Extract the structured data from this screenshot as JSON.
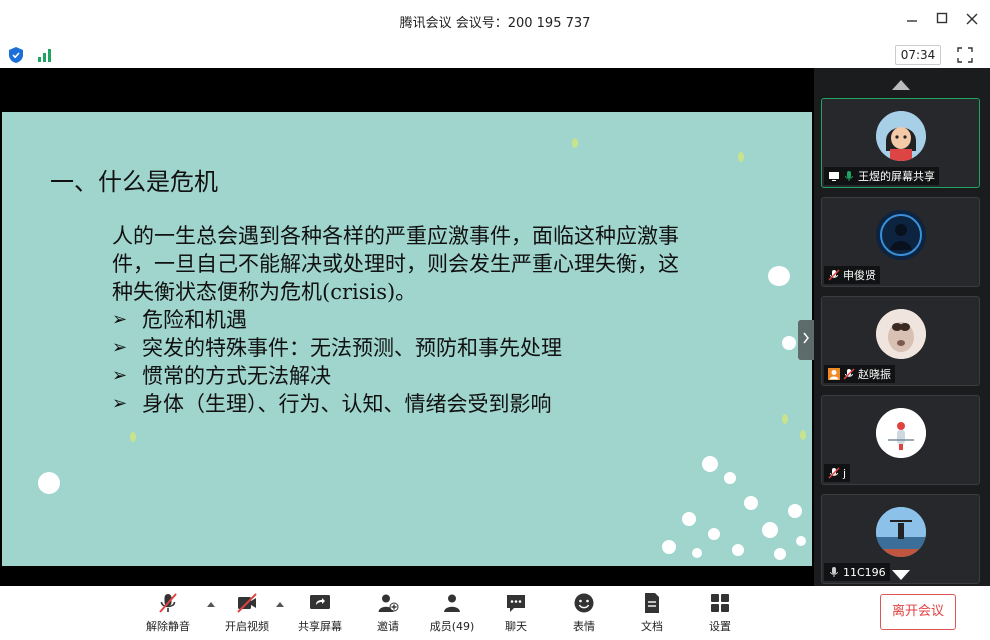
{
  "window": {
    "title": "腾讯会议 会议号：200 195 737",
    "timer": "07:34"
  },
  "slide": {
    "heading": "一、什么是危机",
    "paragraph": "人的一生总会遇到各种各样的严重应激事件，面临这种应激事件，一旦自己不能解决或处理时，则会发生严重心理失衡，这种失衡状态便称为危机(crisis)。",
    "bullet_marker": "➢",
    "bullets": [
      "危险和机遇",
      "突发的特殊事件：无法预测、预防和事先处理",
      "惯常的方式无法解决",
      "身体（生理）、行为、认知、情绪会受到影响"
    ]
  },
  "participants": [
    {
      "name": "王煜的屏幕共享",
      "mic": "on",
      "sharing": true
    },
    {
      "name": "申俊贤",
      "mic": "muted"
    },
    {
      "name": "赵晓振",
      "mic": "muted",
      "badge": true
    },
    {
      "name": "j",
      "mic": "muted"
    },
    {
      "name": "11C196",
      "mic": "on"
    }
  ],
  "toolbar": {
    "unmute": "解除静音",
    "video": "开启视频",
    "share": "共享屏幕",
    "invite": "邀请",
    "members": "成员(49)",
    "chat": "聊天",
    "reactions": "表情",
    "docs": "文档",
    "settings": "设置",
    "leave": "离开会议"
  },
  "colors": {
    "slide_bg": "#9fd5cd",
    "panel_bg": "#1b1c1e",
    "active_border": "#1fa561",
    "leave": "#e04242",
    "muted_red": "#e04242"
  }
}
